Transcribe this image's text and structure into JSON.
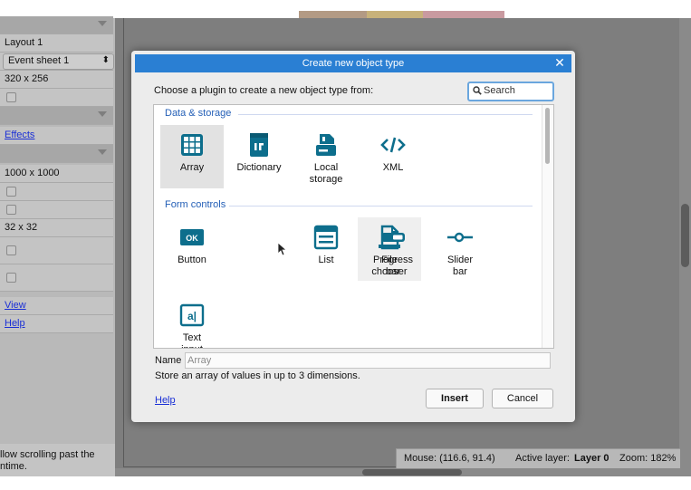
{
  "left_panel": {
    "rows": [
      {
        "text": ""
      },
      {
        "text": "Layout 1"
      },
      {
        "select": "Event sheet 1",
        "select_icon": "up-down-arrows-icon"
      },
      {
        "text": "320 x 256"
      },
      {
        "checkbox": true
      },
      {
        "text": ""
      },
      {
        "link": "Effects"
      },
      {
        "text": ""
      },
      {
        "text": "1000 x 1000"
      },
      {
        "checkbox": true
      },
      {
        "checkbox": true
      },
      {
        "text": "32 x 32"
      },
      {
        "checkbox": true
      },
      {
        "checkbox": true
      },
      {
        "link": "View"
      },
      {
        "link": "Help"
      }
    ],
    "bottom_line1": "llow scrolling past the",
    "bottom_line2": "ntime."
  },
  "status_bar": {
    "mouse": "Mouse: (116.6, 91.4)",
    "active_layer_label": "Active layer:",
    "active_layer_value": "Layer 0",
    "zoom": "Zoom: 182%"
  },
  "dialog": {
    "title": "Create new object type",
    "close_glyph": "✕",
    "prompt": "Choose a plugin to create a new object type from:",
    "search_placeholder": "Search",
    "categories": [
      {
        "name": "Data & storage",
        "plugins": [
          {
            "label": "Array",
            "icon": "grid-icon",
            "selected": true
          },
          {
            "label": "Dictionary",
            "icon": "dictionary-icon"
          },
          {
            "label": "Local storage",
            "icon": "local-storage-icon"
          },
          {
            "label": "XML",
            "icon": "code-brackets-icon"
          }
        ]
      },
      {
        "name": "Form controls",
        "plugins": [
          {
            "label": "Button",
            "icon": "ok-button-icon",
            "badge": "OK"
          },
          {
            "label": "File chooser",
            "icon": "file-icon",
            "hovered": true
          },
          {
            "label": "List",
            "icon": "list-icon"
          },
          {
            "label": "Progress bar",
            "icon": "progress-bar-icon"
          },
          {
            "label": "Slider bar",
            "icon": "slider-icon"
          },
          {
            "label": "Text input",
            "icon": "text-input-icon",
            "badge": "a|"
          }
        ]
      }
    ],
    "name_label": "Name",
    "name_placeholder": "Array",
    "description": "Store an array of values in up to 3 dimensions.",
    "help": "Help",
    "insert": "Insert",
    "cancel": "Cancel"
  },
  "colors": {
    "accent": "#2a7fd3",
    "icon": "#0d6e8c",
    "category_text": "#2560b7"
  }
}
